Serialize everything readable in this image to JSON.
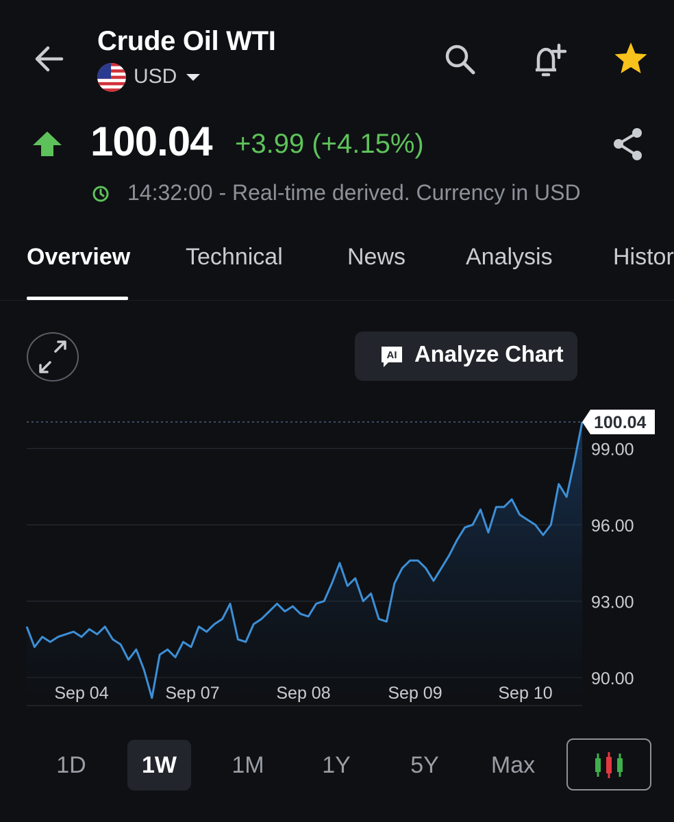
{
  "header": {
    "title": "Crude Oil WTI",
    "currency": "USD"
  },
  "quote": {
    "price": "100.04",
    "change": "+3.99 (+4.15%)",
    "status": "14:32:00 - Real-time derived. Currency in USD",
    "direction": "up"
  },
  "tabs": [
    {
      "label": "Overview",
      "active": true
    },
    {
      "label": "Technical"
    },
    {
      "label": "News"
    },
    {
      "label": "Analysis"
    },
    {
      "label": "Histor"
    }
  ],
  "chart_controls": {
    "analyze_label": "Analyze Chart",
    "analyze_icon_text": "AI"
  },
  "ranges": [
    "1D",
    "1W",
    "1M",
    "1Y",
    "5Y",
    "Max"
  ],
  "active_range": "1W",
  "colors": {
    "background": "#0e1014",
    "positive": "#5ec25a",
    "line": "#3d8fd6",
    "star": "#f7c21b"
  },
  "icons": [
    "back-arrow-icon",
    "us-flag-icon",
    "chevron-down-icon",
    "search-icon",
    "bell-plus-icon",
    "star-icon",
    "up-arrow-icon",
    "share-icon",
    "clock-icon",
    "expand-icon",
    "ai-icon",
    "candlestick-icon"
  ],
  "chart_data": {
    "type": "area",
    "y_ticks": [
      "99.00",
      "96.00",
      "93.00",
      "90.00"
    ],
    "x_tick_labels": [
      "Sep 04",
      "Sep 07",
      "Sep 08",
      "Sep 09",
      "Sep 10"
    ],
    "last_value_label": "100.04",
    "ylim": [
      88.9,
      100.04
    ],
    "grid": true,
    "y_axis_position": "right",
    "series": [
      {
        "values": [
          92.0,
          91.2,
          91.6,
          91.4,
          91.6,
          91.7,
          91.8,
          91.6,
          91.9,
          91.7,
          92.0,
          91.5,
          91.3,
          90.7,
          91.1,
          90.3,
          89.2,
          90.9,
          91.1,
          90.8,
          91.4,
          91.2,
          92.0,
          91.8,
          92.1,
          92.3,
          92.9,
          91.5,
          91.4,
          92.1,
          92.3,
          92.6,
          92.9,
          92.6,
          92.8,
          92.5,
          92.4,
          92.9,
          93.0,
          93.7,
          94.5,
          93.6,
          93.9,
          93.0,
          93.3,
          92.3,
          92.2,
          93.7,
          94.3,
          94.6,
          94.6,
          94.3,
          93.8,
          94.3,
          94.8,
          95.4,
          95.9,
          96.0,
          96.6,
          95.7,
          96.7,
          96.7,
          97.0,
          96.4,
          96.2,
          96.0,
          95.6,
          96.0,
          97.6,
          97.1,
          98.5,
          100.04
        ]
      }
    ]
  }
}
